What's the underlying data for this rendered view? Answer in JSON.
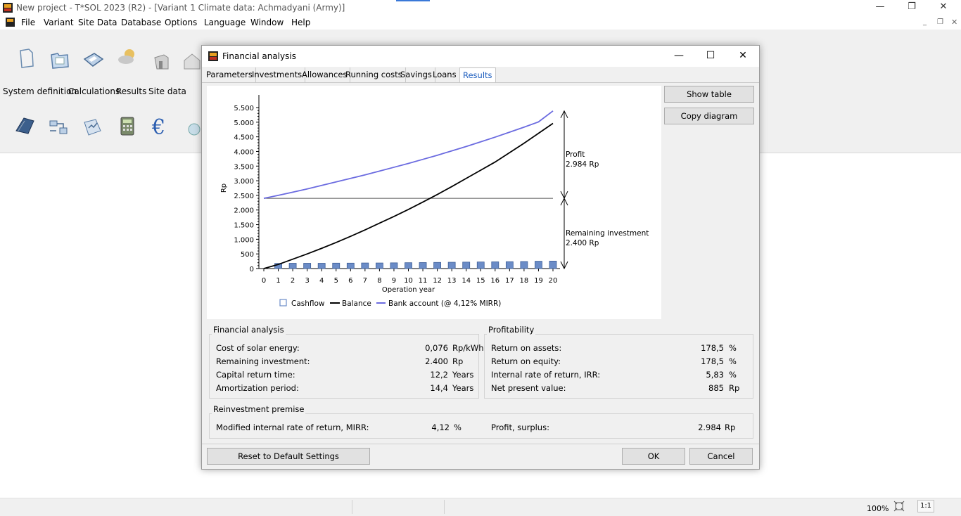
{
  "window": {
    "title": "New project - T*SOL 2023 (R2) - [Variant 1    Climate data: Achmadyani (Army)]",
    "minimize": "—",
    "restore": "❐",
    "close": "✕"
  },
  "menu": [
    "File",
    "Variant",
    "Site Data",
    "Database",
    "Options",
    "Language",
    "Window",
    "Help"
  ],
  "modes": [
    "System definition",
    "Calculations",
    "Results",
    "Site data"
  ],
  "statusbar": {
    "zoom": "100%",
    "ratio": "1:1"
  },
  "dialog": {
    "title": "Financial analysis",
    "tabs": [
      "Parameters",
      "Investments",
      "Allowances",
      "Running costs",
      "Savings",
      "Loans",
      "Results"
    ],
    "active_tab": "Results",
    "buttons": {
      "show_table": "Show table",
      "copy_diagram": "Copy diagram",
      "reset": "Reset to Default Settings",
      "ok": "OK",
      "cancel": "Cancel"
    },
    "financial_analysis": {
      "title": "Financial analysis",
      "rows": [
        {
          "label": "Cost of solar energy:",
          "value": "0,076",
          "unit": "Rp/kWh"
        },
        {
          "label": "Remaining investment:",
          "value": "2.400",
          "unit": "Rp"
        },
        {
          "label": "Capital return time:",
          "value": "12,2",
          "unit": "Years"
        },
        {
          "label": "Amortization period:",
          "value": "14,4",
          "unit": "Years"
        }
      ]
    },
    "profitability": {
      "title": "Profitability",
      "rows": [
        {
          "label": "Return on assets:",
          "value": "178,5",
          "unit": "%"
        },
        {
          "label": "Return on equity:",
          "value": "178,5",
          "unit": "%"
        },
        {
          "label": "Internal rate of return, IRR:",
          "value": "5,83",
          "unit": "%"
        },
        {
          "label": "Net present value:",
          "value": "885",
          "unit": "Rp"
        }
      ]
    },
    "reinvestment": {
      "title": "Reinvestment premise",
      "mirr_label": "Modified internal rate of return, MIRR:",
      "mirr_value": "4,12",
      "mirr_unit": "%",
      "profit_label": "Profit, surplus:",
      "profit_value": "2.984",
      "profit_unit": "Rp"
    }
  },
  "chart_data": {
    "type": "line",
    "xlabel": "Operation year",
    "ylabel": "Rp",
    "xlim": [
      0,
      20
    ],
    "ylim": [
      0,
      5500
    ],
    "yticks": [
      0,
      500,
      1000,
      1500,
      2000,
      2500,
      3000,
      3500,
      4000,
      4500,
      5000,
      5500
    ],
    "ytick_labels": [
      "0",
      "500",
      "1.000",
      "1.500",
      "2.000",
      "2.500",
      "3.000",
      "3.500",
      "4.000",
      "4.500",
      "5.000",
      "5.500"
    ],
    "x": [
      0,
      1,
      2,
      3,
      4,
      5,
      6,
      7,
      8,
      9,
      10,
      11,
      12,
      13,
      14,
      15,
      16,
      17,
      18,
      19,
      20
    ],
    "legend_position": "bottom",
    "series": [
      {
        "name": "Cashflow",
        "kind": "bar",
        "color": "#6b8cc7",
        "values": [
          0,
          175,
          180,
          180,
          180,
          185,
          185,
          190,
          190,
          195,
          200,
          205,
          210,
          215,
          220,
          225,
          230,
          235,
          240,
          250,
          255
        ]
      },
      {
        "name": "Balance",
        "kind": "line",
        "color": "#000000",
        "values": [
          0,
          140,
          320,
          500,
          690,
          890,
          1100,
          1320,
          1550,
          1780,
          2020,
          2270,
          2530,
          2800,
          3080,
          3360,
          3640,
          3960,
          4280,
          4620,
          4960
        ]
      },
      {
        "name": "Bank account (@ 4,12% MIRR)",
        "kind": "line",
        "color": "#6b6be0",
        "values": [
          2400,
          2500,
          2610,
          2720,
          2840,
          2960,
          3080,
          3200,
          3330,
          3460,
          3590,
          3730,
          3870,
          4020,
          4170,
          4330,
          4490,
          4660,
          4830,
          5010,
          5384
        ]
      }
    ],
    "reference_line": {
      "value": 2400,
      "color": "#555555"
    },
    "annotations": {
      "profit_label": "Profit",
      "profit_value": "2.984 Rp",
      "remaining_label": "Remaining investment",
      "remaining_value": "2.400 Rp"
    }
  }
}
